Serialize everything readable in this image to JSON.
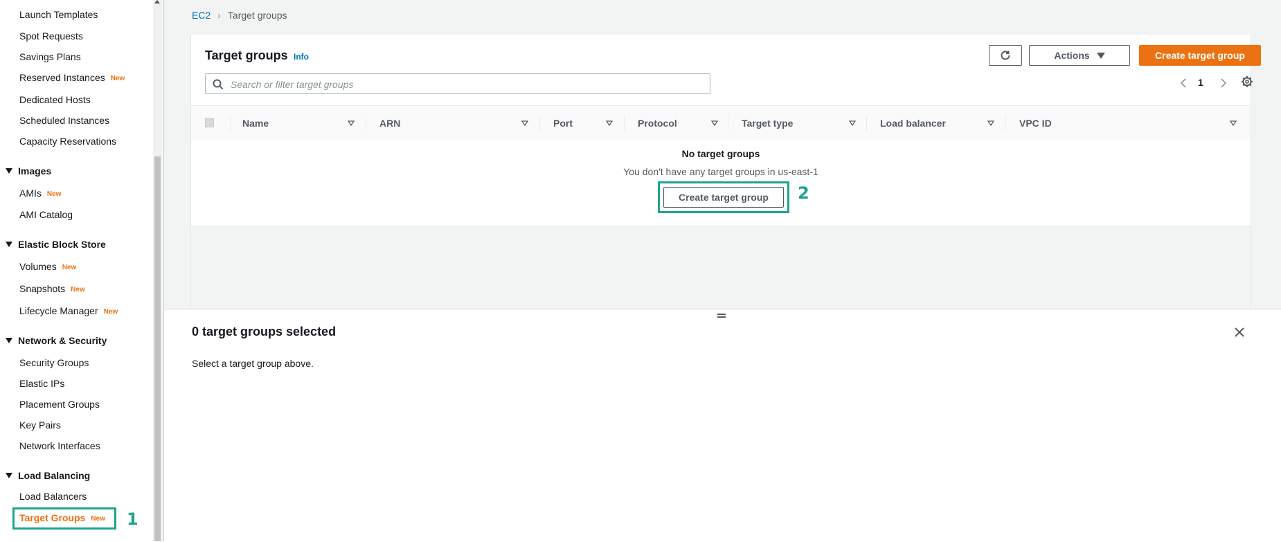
{
  "sidebar": {
    "items": [
      {
        "label": "Launch Templates",
        "new": ""
      },
      {
        "label": "Spot Requests",
        "new": ""
      },
      {
        "label": "Savings Plans",
        "new": ""
      },
      {
        "label": "Reserved Instances",
        "new": "New"
      },
      {
        "label": "Dedicated Hosts",
        "new": ""
      },
      {
        "label": "Scheduled Instances",
        "new": ""
      },
      {
        "label": "Capacity Reservations",
        "new": ""
      }
    ],
    "sections": {
      "images": {
        "title": "Images",
        "items": [
          {
            "label": "AMIs",
            "new": "New"
          },
          {
            "label": "AMI Catalog",
            "new": ""
          }
        ]
      },
      "ebs": {
        "title": "Elastic Block Store",
        "items": [
          {
            "label": "Volumes",
            "new": "New"
          },
          {
            "label": "Snapshots",
            "new": "New"
          },
          {
            "label": "Lifecycle Manager",
            "new": "New"
          }
        ]
      },
      "network": {
        "title": "Network & Security",
        "items": [
          {
            "label": "Security Groups"
          },
          {
            "label": "Elastic IPs"
          },
          {
            "label": "Placement Groups"
          },
          {
            "label": "Key Pairs"
          },
          {
            "label": "Network Interfaces"
          }
        ]
      },
      "lb": {
        "title": "Load Balancing",
        "items": [
          {
            "label": "Load Balancers"
          },
          {
            "label": "Target Groups",
            "new": "New",
            "active": true
          }
        ]
      }
    }
  },
  "annotations": {
    "step1": "1",
    "step2": "2",
    "color": "#1aa58e"
  },
  "breadcrumb": {
    "root": "EC2",
    "current": "Target groups"
  },
  "panel": {
    "title": "Target groups",
    "info": "Info",
    "actions_label": "Actions",
    "create_label": "Create target group",
    "search_placeholder": "Search or filter target groups",
    "page": "1",
    "columns": [
      "Name",
      "ARN",
      "Port",
      "Protocol",
      "Target type",
      "Load balancer",
      "VPC ID"
    ],
    "empty_title": "No target groups",
    "empty_desc": "You don't have any target groups in us-east-1",
    "empty_button": "Create target group"
  },
  "split_panel": {
    "title": "0 target groups selected",
    "desc": "Select a target group above."
  },
  "colors": {
    "accent": "#ec7211",
    "link": "#0073bb",
    "background": "#f2f3f3"
  }
}
